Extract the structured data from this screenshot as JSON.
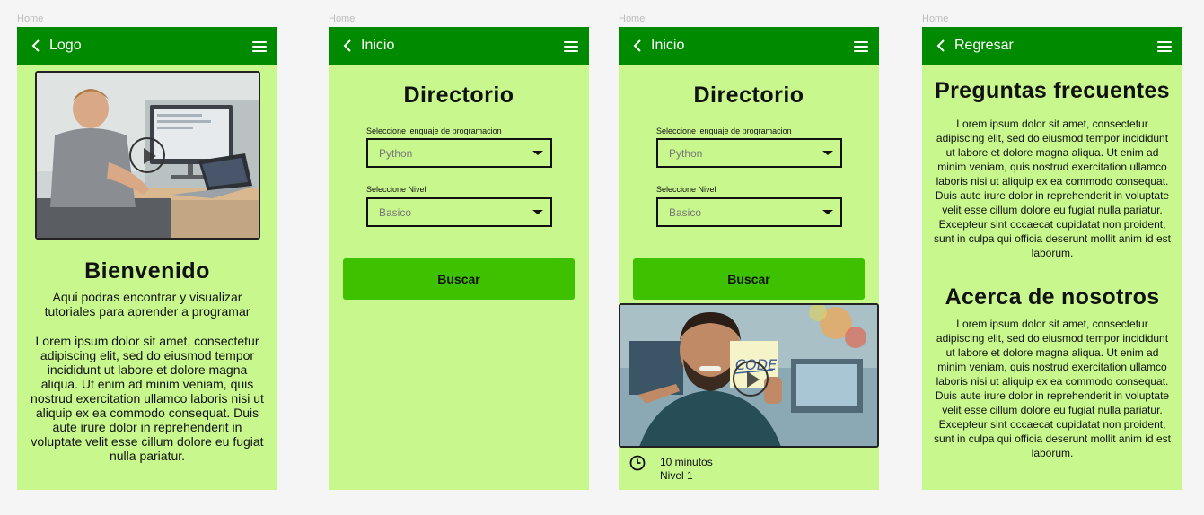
{
  "screens": [
    {
      "label": "Home",
      "header": {
        "title": "Logo"
      },
      "welcome_title": "Bienvenido",
      "subtitle": "Aqui podras encontrar y visualizar tutoriales para aprender a programar",
      "body": "Lorem ipsum dolor sit amet, consectetur adipiscing elit, sed do eiusmod tempor incididunt ut labore et dolore magna aliqua. Ut enim ad minim veniam, quis nostrud exercitation ullamco laboris nisi ut aliquip ex ea commodo consequat. Duis aute irure dolor in reprehenderit in voluptate velit esse cillum dolore eu fugiat nulla pariatur."
    },
    {
      "label": "Home",
      "header": {
        "title": "Inicio"
      },
      "page_title": "Directorio",
      "language_label": "Seleccione lenguaje de programacion",
      "language_value": "Python",
      "level_label": "Seleccione Nivel",
      "level_value": "Basico",
      "search_label": "Buscar"
    },
    {
      "label": "Home",
      "header": {
        "title": "Inicio"
      },
      "page_title": "Directorio",
      "language_label": "Seleccione lenguaje de programacion",
      "language_value": "Python",
      "level_label": "Seleccione Nivel",
      "level_value": "Basico",
      "search_label": "Buscar",
      "video_note_text": "CODE",
      "duration": "10 minutos",
      "level": "Nivel 1"
    },
    {
      "label": "Home",
      "header": {
        "title": "Regresar"
      },
      "faq_title": "Preguntas frecuentes",
      "faq_body": "Lorem ipsum dolor sit amet, consectetur adipiscing elit, sed do eiusmod tempor incididunt ut labore et dolore magna aliqua. Ut enim ad minim veniam, quis nostrud exercitation ullamco laboris nisi ut aliquip ex ea commodo consequat. Duis aute irure dolor in reprehenderit in voluptate velit esse cillum dolore eu fugiat nulla pariatur. Excepteur sint occaecat cupidatat non proident, sunt in culpa qui officia deserunt mollit anim id est laborum.",
      "about_title": "Acerca de nosotros",
      "about_body": "Lorem ipsum dolor sit amet, consectetur adipiscing elit, sed do eiusmod tempor incididunt ut labore et dolore magna aliqua. Ut enim ad minim veniam, quis nostrud exercitation ullamco laboris nisi ut aliquip ex ea commodo consequat. Duis aute irure dolor in reprehenderit in voluptate velit esse cillum dolore eu fugiat nulla pariatur. Excepteur sint occaecat cupidatat non proident, sunt in culpa qui officia deserunt mollit anim id est laborum."
    }
  ],
  "colors": {
    "header_green": "#008a00",
    "screen_bg": "#c8f78e",
    "button_green": "#3ec200",
    "canvas_bg": "#f5f5f5"
  },
  "icons": {
    "back": "chevron-left-icon",
    "menu": "hamburger-menu-icon",
    "play": "play-icon",
    "dropdown": "caret-down-icon",
    "time": "clock-icon"
  }
}
